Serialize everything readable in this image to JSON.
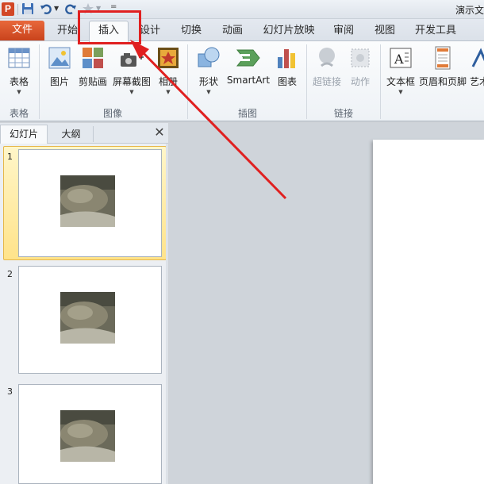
{
  "title_bar": {
    "app_icon_letter": "P",
    "title_text": "演示文"
  },
  "file_tab": "文件",
  "tabs": [
    {
      "label": "开始"
    },
    {
      "label": "插入"
    },
    {
      "label": "设计"
    },
    {
      "label": "切换"
    },
    {
      "label": "动画"
    },
    {
      "label": "幻灯片放映"
    },
    {
      "label": "审阅"
    },
    {
      "label": "视图"
    },
    {
      "label": "开发工具"
    }
  ],
  "active_tab": "插入",
  "ribbon": {
    "groups": [
      {
        "label": "表格",
        "buttons": [
          {
            "label": "表格",
            "icon": "table-icon",
            "dropdown": true
          }
        ]
      },
      {
        "label": "图像",
        "buttons": [
          {
            "label": "图片",
            "icon": "picture-icon",
            "dropdown": false
          },
          {
            "label": "剪贴画",
            "icon": "clipart-icon",
            "dropdown": false
          },
          {
            "label": "屏幕截图",
            "icon": "screenshot-icon",
            "dropdown": true
          },
          {
            "label": "相册",
            "icon": "photo-album-icon",
            "dropdown": true
          }
        ]
      },
      {
        "label": "插图",
        "buttons": [
          {
            "label": "形状",
            "icon": "shapes-icon",
            "dropdown": true
          },
          {
            "label": "SmartArt",
            "icon": "smartart-icon",
            "dropdown": false
          },
          {
            "label": "图表",
            "icon": "chart-icon",
            "dropdown": false
          }
        ]
      },
      {
        "label": "链接",
        "buttons": [
          {
            "label": "超链接",
            "icon": "hyperlink-icon",
            "dropdown": false,
            "disabled": true
          },
          {
            "label": "动作",
            "icon": "action-icon",
            "dropdown": false,
            "disabled": true
          }
        ]
      },
      {
        "label": "",
        "buttons": [
          {
            "label": "文本框",
            "icon": "textbox-icon",
            "dropdown": true
          },
          {
            "label": "页眉和页脚",
            "icon": "header-footer-icon",
            "dropdown": false
          },
          {
            "label": "艺术",
            "icon": "wordart-icon",
            "dropdown": false
          }
        ]
      }
    ]
  },
  "left_pane": {
    "tabs": [
      {
        "label": "幻灯片"
      },
      {
        "label": "大纲"
      }
    ],
    "close_symbol": "✕",
    "slides": [
      {
        "number": "1",
        "selected": true
      },
      {
        "number": "2",
        "selected": false
      },
      {
        "number": "3",
        "selected": false
      }
    ]
  },
  "colors": {
    "file_tab": "#d9542b",
    "highlight": "#e02020",
    "selected_thumb": "#ffe38a"
  }
}
